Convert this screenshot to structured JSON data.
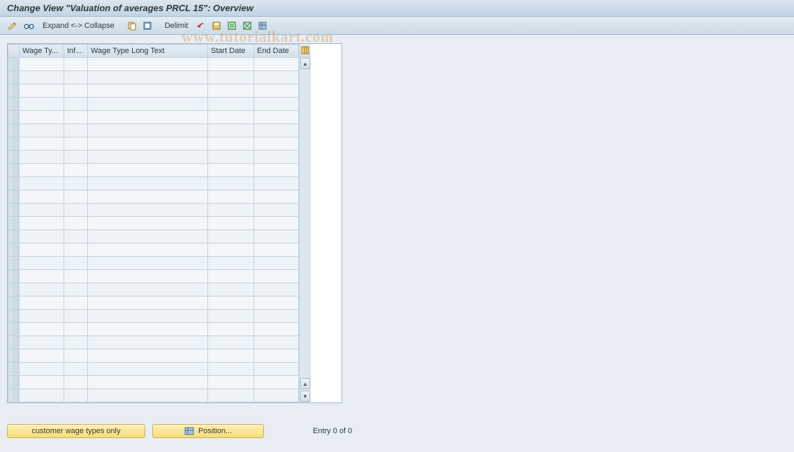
{
  "title": "Change View \"Valuation of averages PRCL 15\": Overview",
  "toolbar": {
    "expand_collapse": "Expand <-> Collapse",
    "delimit": "Delimit"
  },
  "grid": {
    "headers": {
      "sel": "",
      "wage_type": "Wage Ty...",
      "inf": "Inf...",
      "long_text": "Wage Type Long Text",
      "start_date": "Start Date",
      "end_date": "End Date"
    },
    "row_count": 26
  },
  "buttons": {
    "customer_wage": "customer wage types only",
    "position": "Position..."
  },
  "footer": {
    "entry": "Entry 0 of 0"
  },
  "watermark": "www.tutorialkart.com"
}
